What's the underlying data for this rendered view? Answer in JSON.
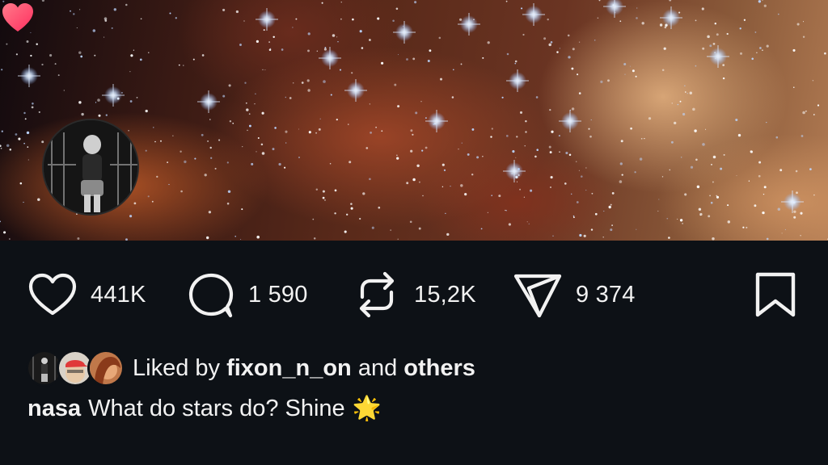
{
  "post": {
    "image_alt": "star cluster nebula",
    "author_avatar": "user-avatar",
    "reaction_badge": "heart-icon"
  },
  "actions": {
    "like": {
      "icon": "heart-outline-icon",
      "count": "441K"
    },
    "comment": {
      "icon": "comment-bubble-icon",
      "count": "1 590"
    },
    "repost": {
      "icon": "repost-icon",
      "count": "15,2K"
    },
    "share": {
      "icon": "send-icon",
      "count": "9 374"
    },
    "save": {
      "icon": "bookmark-icon"
    }
  },
  "likes": {
    "prefix": "Liked by",
    "user": "fixon_n_on",
    "joiner": "and",
    "others": "others"
  },
  "caption": {
    "username": "nasa",
    "text": "What do stars do? Shine",
    "emoji": "🌟"
  },
  "colors": {
    "background": "#0d1116",
    "text": "#f2f2f2",
    "heart_badge": "#ff3b6b"
  }
}
